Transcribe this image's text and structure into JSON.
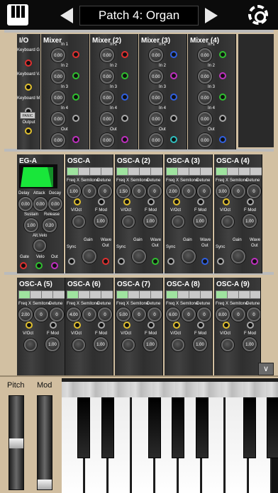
{
  "patch": {
    "title": "Patch 4: Organ"
  },
  "io": {
    "title": "I/O",
    "labels": [
      "Keyboard Gate/Velo",
      "Keyboard V/Oct",
      "Keyboard Modulation",
      "Output"
    ],
    "panic": "PANIC"
  },
  "mixers": [
    {
      "title": "Mixer"
    },
    {
      "title": "Mixer (2)"
    },
    {
      "title": "Mixer (3)"
    },
    {
      "title": "Mixer (4)"
    }
  ],
  "mixer_labels": {
    "in1": "In 1",
    "in2": "In 2",
    "in3": "In 3",
    "in4": "In 4",
    "out": "Out",
    "value": "0.00",
    "unit": "dB"
  },
  "eg": {
    "title": "EG-A",
    "delay": "Delay",
    "attack": "Attack",
    "decay": "Decay",
    "sustain": "Sustain",
    "release": "Release",
    "alt_velo": "Alt.Velo",
    "gate": "Gate",
    "velo": "Velo",
    "out": "Out",
    "v_delay": "0.00",
    "v_attack": "0.00",
    "v_decay": "0.00",
    "v_sustain": "1.00",
    "v_release": "0.20"
  },
  "osc_labels": {
    "freq_x": "Freq X",
    "semitone": "Semitone",
    "detune": "Detune",
    "voct": "V/Oct",
    "fmod": "F Mod",
    "sync": "Sync",
    "gain": "Gain",
    "wave": "Wave",
    "out": "Out",
    "cents": "cents"
  },
  "osc_row1": [
    {
      "title": "OSC-A",
      "freq": "1.00",
      "semi": "0",
      "detune": "0",
      "fmod": "1.00"
    },
    {
      "title": "OSC-A (2)",
      "freq": "1.50",
      "semi": "0",
      "detune": "0",
      "fmod": "1.00"
    },
    {
      "title": "OSC-A (3)",
      "freq": "2.00",
      "semi": "0",
      "detune": "0",
      "fmod": "1.00"
    },
    {
      "title": "OSC-A (4)",
      "freq": "3.00",
      "semi": "0",
      "detune": "0",
      "fmod": "1.00"
    }
  ],
  "osc_row2": [
    {
      "title": "OSC-A (5)",
      "freq": "2.00",
      "semi": "0",
      "detune": "0",
      "fmod": "1.00"
    },
    {
      "title": "OSC-A (6)",
      "freq": "4.00",
      "semi": "0",
      "detune": "0",
      "fmod": "1.00"
    },
    {
      "title": "OSC-A (7)",
      "freq": "5.00",
      "semi": "0",
      "detune": "0",
      "fmod": "1.00"
    },
    {
      "title": "OSC-A (8)",
      "freq": "6.00",
      "semi": "0",
      "detune": "0",
      "fmod": "1.00"
    },
    {
      "title": "OSC-A (9)",
      "freq": "8.00",
      "semi": "0",
      "detune": "0",
      "fmod": "1.00"
    }
  ],
  "controls": {
    "pitch": "Pitch",
    "mod": "Mod"
  },
  "icons": {
    "menu_keyboard": "keyboard-icon",
    "prev": "arrow-left-icon",
    "next": "arrow-right-icon",
    "settings": "gear-icon",
    "collapse": "chevron-down-icon"
  },
  "colors": {
    "green_screen": "#19e63a",
    "jack_colors": [
      "#e03030",
      "#30c030",
      "#3060e0",
      "#c030c0",
      "#e0c030",
      "#30c0c0"
    ]
  }
}
